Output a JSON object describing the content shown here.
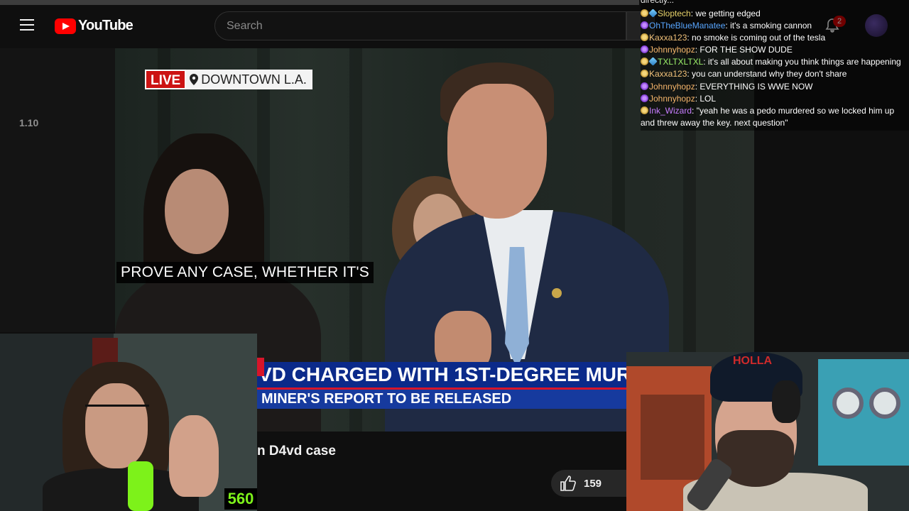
{
  "header": {
    "logo_text": "YouTube",
    "search_placeholder": "Search",
    "notification_count": "2"
  },
  "sidebar": {
    "number": "1.10"
  },
  "video": {
    "live_label": "LIVE",
    "location_label": "DOWNTOWN L.A.",
    "caption": "PROVE ANY CASE, WHETHER IT'S",
    "headline": "VD CHARGED WITH  1ST-DEGREE MURD",
    "subheadline": "MINER'S REPORT TO BE RELEASED",
    "title": "n D4vd case",
    "likes": "159"
  },
  "streamer": {
    "counter": "560",
    "cap_text": "HOLLA"
  },
  "chat": {
    "top_fragment": "directly...",
    "messages": [
      {
        "user": "Sloptech",
        "color": "#e8d36a",
        "badges": [
          "star",
          "gem"
        ],
        "text": "we getting edged"
      },
      {
        "user": "OhTheBlueManatee",
        "color": "#58a6ff",
        "badges": [
          "purple"
        ],
        "text": "it's a smoking cannon"
      },
      {
        "user": "Kaxxa123",
        "color": "#f2c27a",
        "badges": [
          "star"
        ],
        "text": "no smoke is coming out of the tesla"
      },
      {
        "user": "Johnnyhopz",
        "color": "#f5b56b",
        "badges": [
          "purple"
        ],
        "text": "FOR THE SHOW DUDE"
      },
      {
        "user": "TXLTXLTXL",
        "color": "#9df16b",
        "badges": [
          "star",
          "gem"
        ],
        "text": "it's all about making you think things are happening"
      },
      {
        "user": "Kaxxa123",
        "color": "#f2c27a",
        "badges": [
          "star"
        ],
        "text": "you can understand why they don't share"
      },
      {
        "user": "Johnnyhopz",
        "color": "#f5b56b",
        "badges": [
          "purple"
        ],
        "text": "EVERYTHING IS WWE NOW"
      },
      {
        "user": "Johnnyhopz",
        "color": "#f5b56b",
        "badges": [
          "purple"
        ],
        "text": "LOL"
      },
      {
        "user": "Ink_Wizard",
        "color": "#c77dff",
        "badges": [
          "star"
        ],
        "text": "\"yeah he was a pedo murdered so we locked him up and threw away the key. next question\""
      }
    ]
  }
}
